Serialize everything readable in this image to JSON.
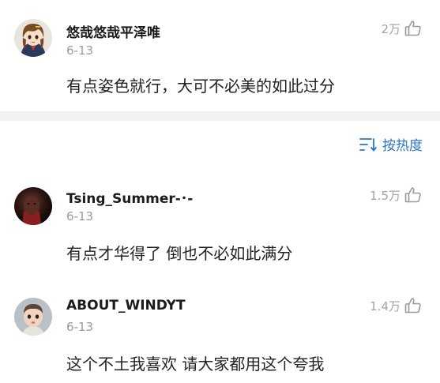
{
  "comments": [
    {
      "username": "悠哉悠哉平泽唯",
      "date": "6-13",
      "text": "有点姿色就行，大可不必美的如此过分",
      "likes": "2万"
    },
    {
      "username": "Tsing_Summer-･-",
      "date": "6-13",
      "text": "有点才华得了 倒也不必如此满分",
      "likes": "1.5万"
    },
    {
      "username": "ABOUT_WINDYT",
      "date": "6-13",
      "text": "这个不土我喜欢 请大家都用这个夸我",
      "likes": "1.4万"
    }
  ],
  "sort": {
    "label": "按热度",
    "icon": "sort-lines-icon"
  },
  "colors": {
    "accent": "#2f73c7",
    "muted": "#9a9a9a",
    "separator": "#f2f2f2",
    "text": "#222222"
  },
  "icons": {
    "like": "thumbs-up-outline-icon"
  }
}
